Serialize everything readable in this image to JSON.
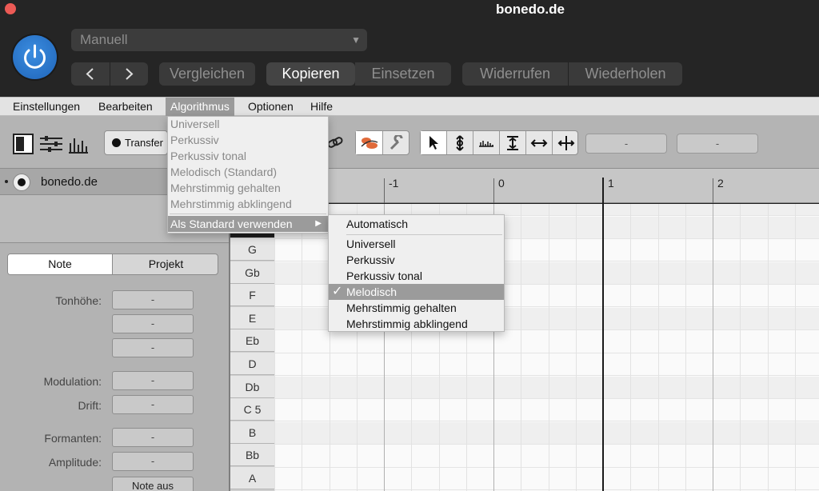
{
  "window": {
    "title": "bonedo.de"
  },
  "header": {
    "preset": "Manuell",
    "buttons": {
      "compare": "Vergleichen",
      "copy": "Kopieren",
      "paste": "Einsetzen",
      "undo": "Widerrufen",
      "redo": "Wiederholen"
    }
  },
  "menubar": {
    "items": [
      "Einstellungen",
      "Bearbeiten",
      "Algorithmus",
      "Optionen",
      "Hilfe"
    ],
    "active": "Algorithmus"
  },
  "toolbar": {
    "transfer_label": "Transfer",
    "field1": "-",
    "field2": "-"
  },
  "track": {
    "name": "bonedo.de"
  },
  "inspector": {
    "tabs": [
      "Note",
      "Projekt"
    ],
    "selected_tab": "Note",
    "labels": {
      "pitch": "Tonhöhe:",
      "modulation": "Modulation:",
      "drift": "Drift:",
      "formants": "Formanten:",
      "amplitude": "Amplitude:"
    },
    "values": {
      "pitch1": "-",
      "pitch2": "-",
      "pitch3": "-",
      "modulation": "-",
      "drift": "-",
      "formants": "-",
      "amplitude": "-"
    },
    "note_off_button": "Note aus"
  },
  "ruler": {
    "marks": [
      "-1",
      "0",
      "1",
      "2"
    ]
  },
  "keys": [
    "G",
    "Gb",
    "F",
    "E",
    "Eb",
    "D",
    "Db",
    "C 5",
    "B",
    "Bb",
    "A"
  ],
  "algorithm_menu": {
    "items": [
      "Universell",
      "Perkussiv",
      "Perkussiv tonal",
      "Melodisch (Standard)",
      "Mehrstimmig gehalten",
      "Mehrstimmig abklingend"
    ],
    "default_item": "Als Standard verwenden"
  },
  "default_submenu": {
    "auto": "Automatisch",
    "items": [
      "Universell",
      "Perkussiv",
      "Perkussiv tonal",
      "Melodisch",
      "Mehrstimmig gehalten",
      "Mehrstimmig abklingend"
    ],
    "checked": "Melodisch",
    "checkmark": "✓"
  },
  "colors": {
    "accent": "#2a74c9",
    "close": "#ec5a55",
    "highlight": "#9b9b9b"
  }
}
